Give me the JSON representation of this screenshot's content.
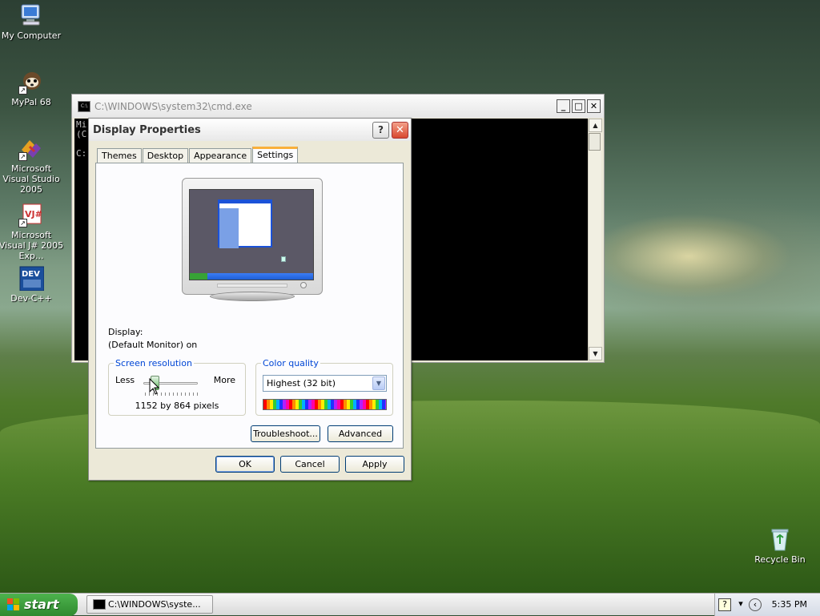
{
  "desktop": {
    "icons": [
      {
        "label": "My Computer"
      },
      {
        "label": "MyPal 68"
      },
      {
        "label": "Microsoft Visual Studio 2005"
      },
      {
        "label": "Microsoft Visual J# 2005 Exp..."
      },
      {
        "label": "Dev-C++"
      },
      {
        "label": "Recycle Bin"
      }
    ]
  },
  "cmd": {
    "title": "C:\\WINDOWS\\system32\\cmd.exe",
    "lines": [
      "Mi",
      "(C",
      "",
      "C:"
    ],
    "minimize": "_",
    "maximize": "□",
    "close": "✕"
  },
  "dialog": {
    "title": "Display Properties",
    "help": "?",
    "close": "✕",
    "tabs": [
      "Themes",
      "Desktop",
      "Appearance",
      "Settings"
    ],
    "active_tab": "Settings",
    "display_label": "Display:",
    "display_value": "(Default Monitor) on",
    "resolution": {
      "legend": "Screen resolution",
      "less": "Less",
      "more": "More",
      "value": "1152 by 864 pixels",
      "slider_fraction": 0.15
    },
    "color_quality": {
      "legend": "Color quality",
      "selected": "Highest (32 bit)"
    },
    "buttons": {
      "troubleshoot": "Troubleshoot...",
      "advanced": "Advanced",
      "ok": "OK",
      "cancel": "Cancel",
      "apply": "Apply"
    }
  },
  "taskbar": {
    "start": "start",
    "task_cmd": "C:\\WINDOWS\\syste...",
    "clock": "5:35 PM"
  }
}
